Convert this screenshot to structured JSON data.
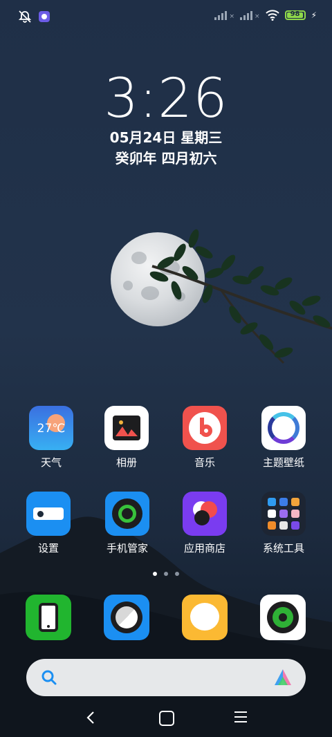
{
  "status_bar": {
    "battery_level": "98",
    "battery_color": "#8fd94a",
    "left_icons": [
      "bell-off-icon",
      "app-notification-icon"
    ],
    "right_icons": [
      "signal-1-icon",
      "signal-2-icon",
      "wifi-icon",
      "battery-icon",
      "charging-icon"
    ]
  },
  "lockscreen": {
    "time": "3:26",
    "date": "05月24日 星期三",
    "lunar_date": "癸卯年 四月初六"
  },
  "apps_row1": [
    {
      "label": "天气",
      "icon": "weather-icon",
      "temp": "27℃"
    },
    {
      "label": "相册",
      "icon": "gallery-icon"
    },
    {
      "label": "音乐",
      "icon": "music-icon"
    },
    {
      "label": "主题壁纸",
      "icon": "theme-icon"
    }
  ],
  "apps_row2": [
    {
      "label": "设置",
      "icon": "settings-icon"
    },
    {
      "label": "手机管家",
      "icon": "security-icon"
    },
    {
      "label": "应用商店",
      "icon": "app-store-icon"
    },
    {
      "label": "系统工具",
      "icon": "tools-folder-icon"
    }
  ],
  "page_indicator": {
    "pages": 3,
    "current": 1
  },
  "dock": [
    {
      "icon": "phone-icon"
    },
    {
      "icon": "browser-icon"
    },
    {
      "icon": "messages-icon"
    },
    {
      "icon": "camera-icon"
    }
  ],
  "search_bar": {
    "icon": "search-icon",
    "assistant_icon": "assistant-logo-icon"
  },
  "nav_bar": {
    "buttons": [
      "back-icon",
      "home-icon",
      "recents-icon"
    ]
  }
}
